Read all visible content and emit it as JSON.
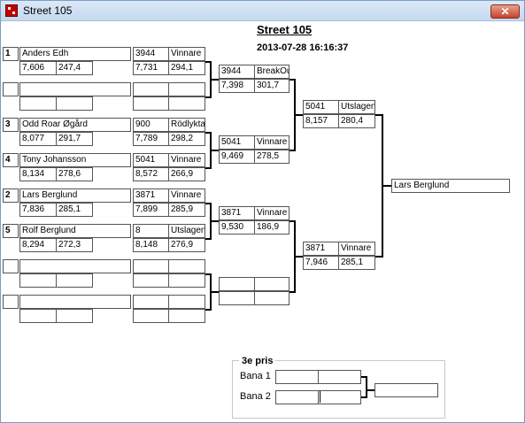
{
  "window": {
    "title": "Street 105",
    "close_label": "✕"
  },
  "header": {
    "title": "Street 105",
    "datetime": "2013-07-28 16:16:37"
  },
  "round1": [
    {
      "seed": "1",
      "name": "Anders Edh",
      "rt": "7,606",
      "speed": "247,4",
      "opp_id": "3944",
      "result": "Vinnare",
      "opp_rt": "7,731",
      "opp_speed": "294,1"
    },
    {
      "seed": "",
      "name": "",
      "rt": "",
      "speed": "",
      "opp_id": "",
      "result": "",
      "opp_rt": "",
      "opp_speed": ""
    },
    {
      "seed": "3",
      "name": "Odd Roar Øgård",
      "rt": "8,077",
      "speed": "291,7",
      "opp_id": "900",
      "result": "Rödlykta",
      "opp_rt": "7,789",
      "opp_speed": "298,2"
    },
    {
      "seed": "4",
      "name": "Tony Johansson",
      "rt": "8,134",
      "speed": "278,6",
      "opp_id": "5041",
      "result": "Vinnare",
      "opp_rt": "8,572",
      "opp_speed": "266,9"
    },
    {
      "seed": "2",
      "name": "Lars Berglund",
      "rt": "7,836",
      "speed": "285,1",
      "opp_id": "3871",
      "result": "Vinnare",
      "opp_rt": "7,899",
      "opp_speed": "285,9"
    },
    {
      "seed": "5",
      "name": "Rolf Berglund",
      "rt": "8,294",
      "speed": "272,3",
      "opp_id": "8",
      "result": "Utslagen",
      "opp_rt": "8,148",
      "opp_speed": "276,9"
    },
    {
      "seed": "",
      "name": "",
      "rt": "",
      "speed": "",
      "opp_id": "",
      "result": "",
      "opp_rt": "",
      "opp_speed": ""
    },
    {
      "seed": "",
      "name": "",
      "rt": "",
      "speed": "",
      "opp_id": "",
      "result": "",
      "opp_rt": "",
      "opp_speed": ""
    }
  ],
  "round2": [
    {
      "id": "3944",
      "result": "BreakOut",
      "rt": "7,398",
      "speed": "301,7"
    },
    {
      "id": "5041",
      "result": "Vinnare",
      "rt": "9,469",
      "speed": "278,5"
    },
    {
      "id": "3871",
      "result": "Vinnare",
      "rt": "9,530",
      "speed": "186,9"
    },
    {
      "id": "",
      "result": "",
      "rt": "",
      "speed": ""
    }
  ],
  "round3": [
    {
      "id": "5041",
      "result": "Utslagen",
      "rt": "8,157",
      "speed": "280,4"
    },
    {
      "id": "3871",
      "result": "Vinnare",
      "rt": "7,946",
      "speed": "285,1"
    }
  ],
  "winner": {
    "name": "Lars Berglund"
  },
  "third_place": {
    "title": "3e pris",
    "lane1_label": "Bana 1",
    "lane2_label": "Bana 2"
  }
}
